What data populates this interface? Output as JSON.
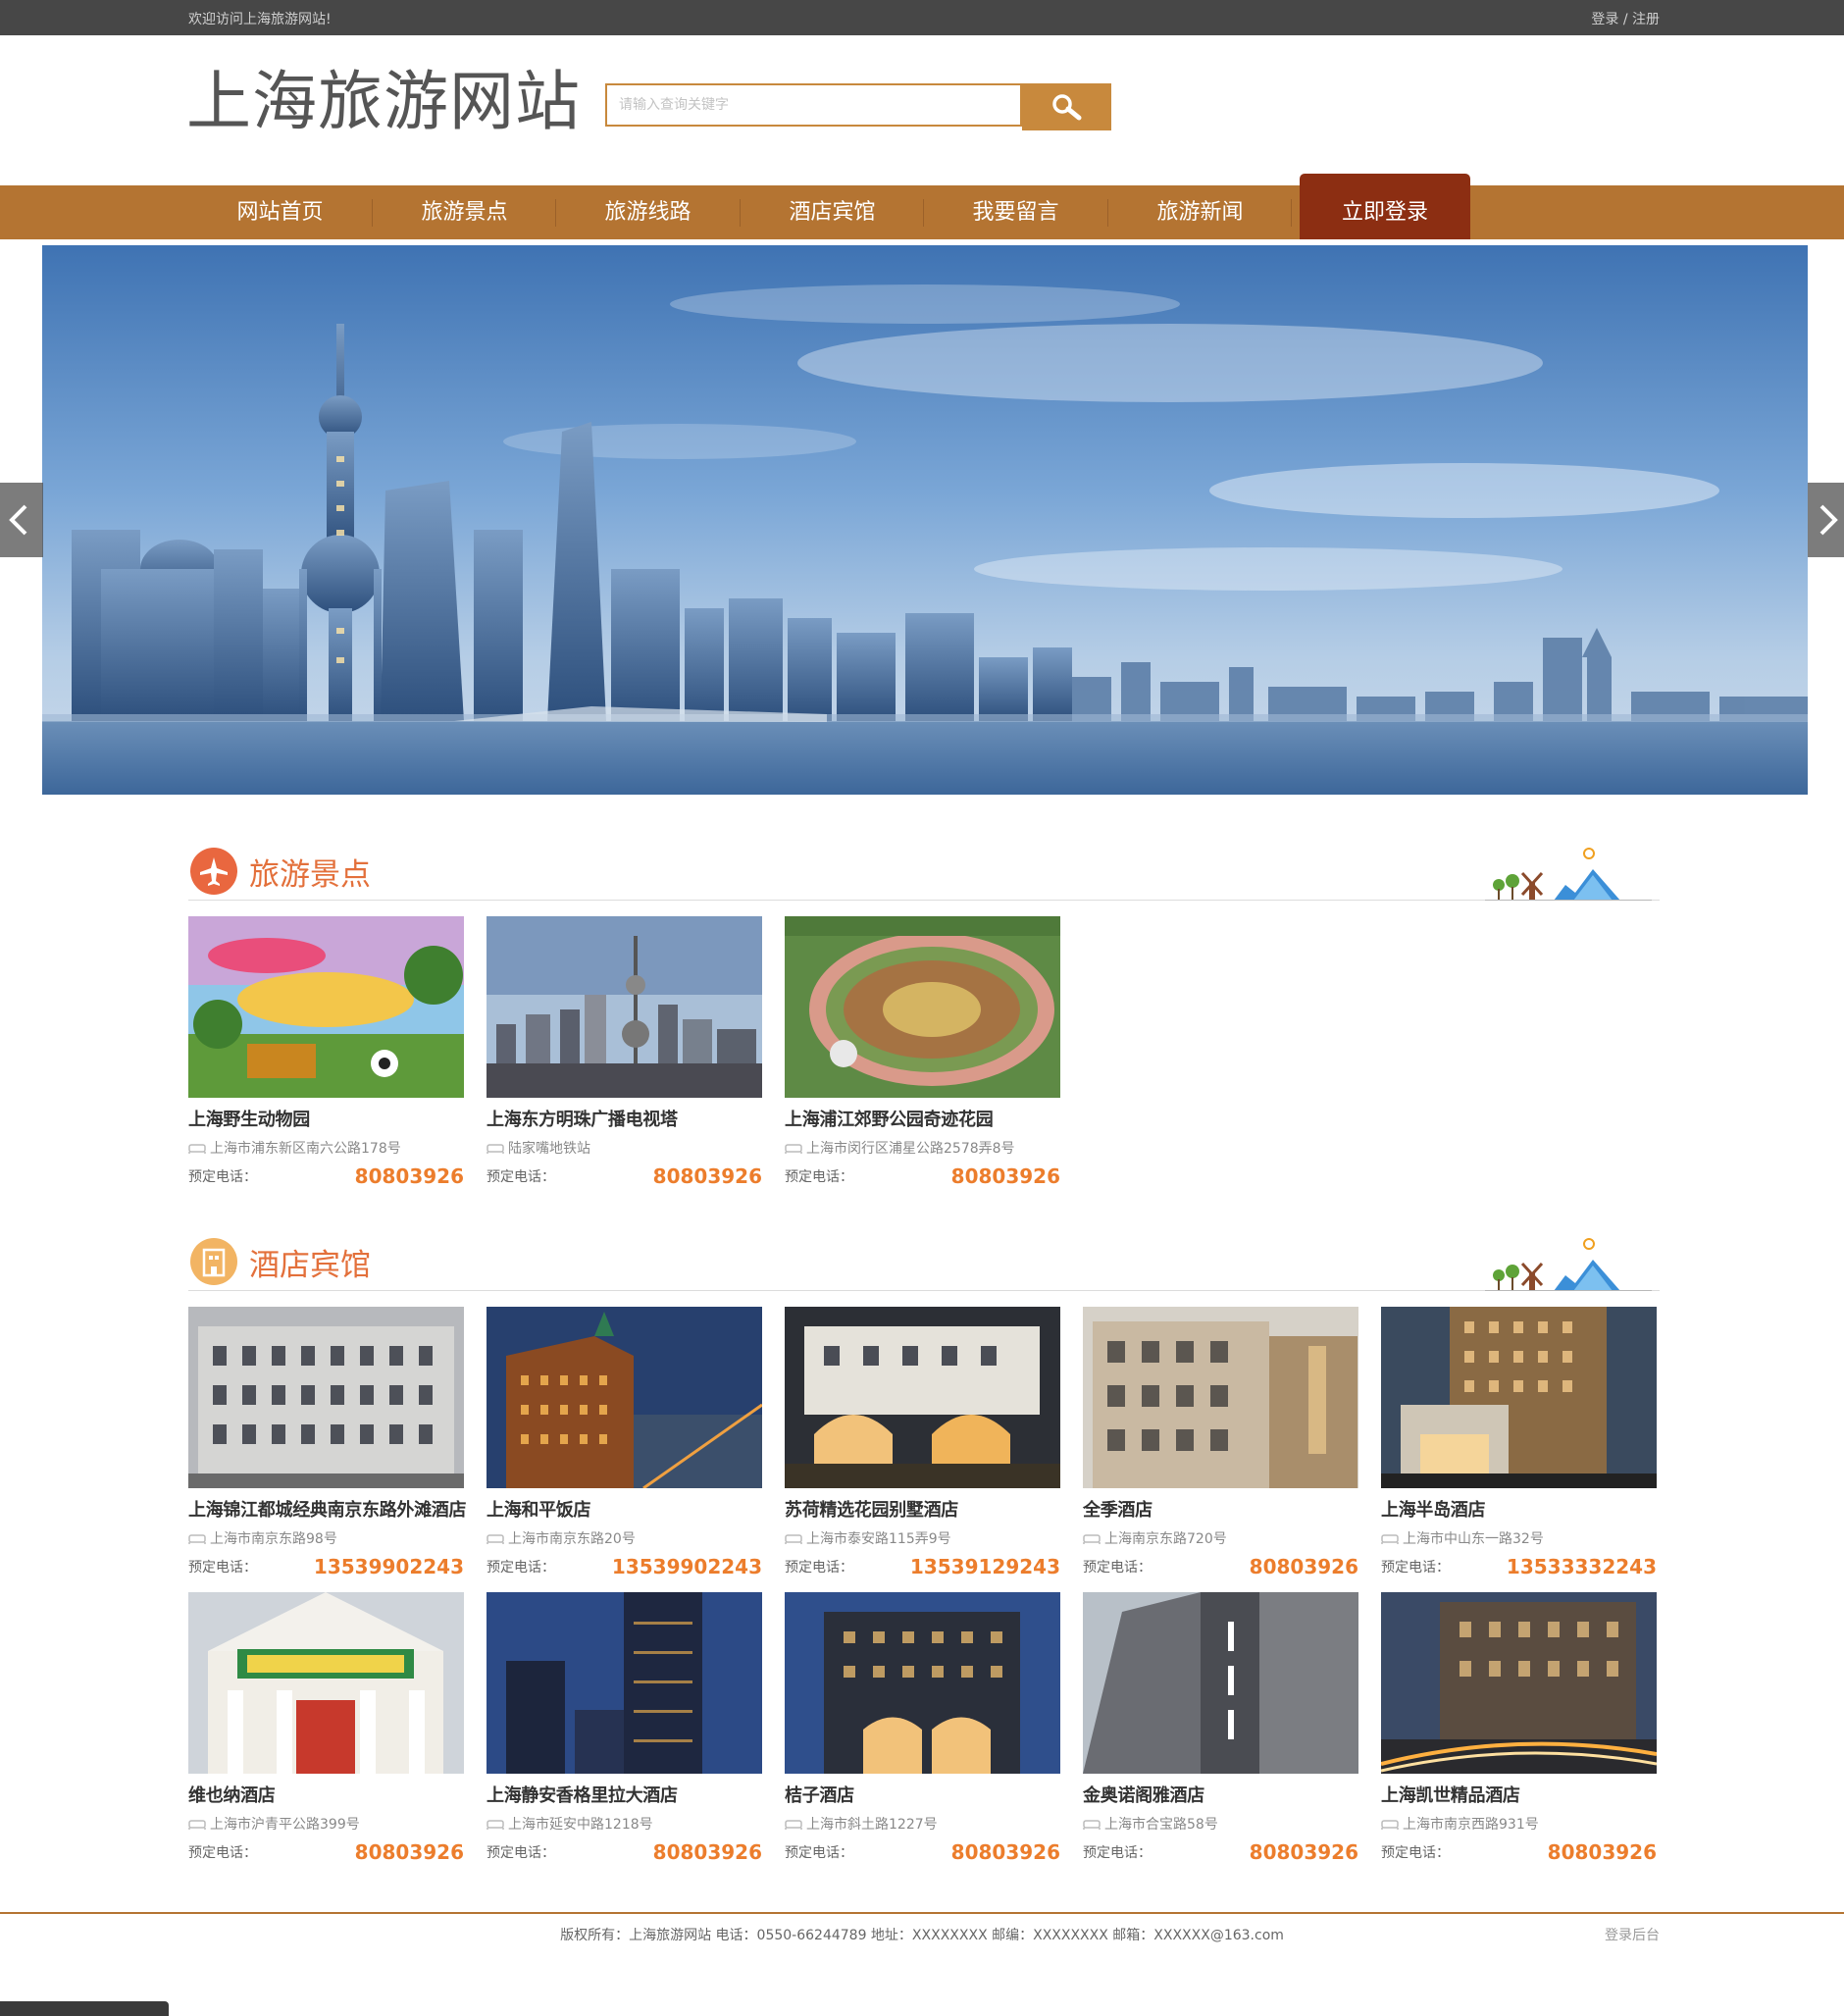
{
  "topbar": {
    "welcome": "欢迎访问上海旅游网站!",
    "login": "登录",
    "slash": " / ",
    "register": "注册"
  },
  "header": {
    "logo": "上海旅游网站",
    "search_placeholder": "请输入查询关键字"
  },
  "nav": [
    "网站首页",
    "旅游景点",
    "旅游线路",
    "酒店宾馆",
    "我要留言",
    "旅游新闻",
    "立即登录"
  ],
  "sections": {
    "spots": {
      "title": "旅游景点"
    },
    "hotels": {
      "title": "酒店宾馆"
    }
  },
  "phone_label": "预定电话：",
  "spots": [
    {
      "name": "上海野生动物园",
      "addr": "上海市浦东新区南六公路178号",
      "phone": "80803926"
    },
    {
      "name": "上海东方明珠广播电视塔",
      "addr": "陆家嘴地铁站",
      "phone": "80803926"
    },
    {
      "name": "上海浦江郊野公园奇迹花园",
      "addr": "上海市闵行区浦星公路2578弄8号",
      "phone": "80803926"
    }
  ],
  "hotels": [
    {
      "name": "上海锦江都城经典南京东路外滩酒店",
      "addr": "上海市南京东路98号",
      "phone": "13539902243"
    },
    {
      "name": "上海和平饭店",
      "addr": "上海市南京东路20号",
      "phone": "13539902243"
    },
    {
      "name": "苏荷精选花园别墅酒店",
      "addr": "上海市泰安路115弄9号",
      "phone": "13539129243"
    },
    {
      "name": "全季酒店",
      "addr": "上海南京东路720号",
      "phone": "80803926"
    },
    {
      "name": "上海半岛酒店",
      "addr": "上海市中山东一路32号",
      "phone": "13533332243"
    },
    {
      "name": "维也纳酒店",
      "addr": "上海市沪青平公路399号",
      "phone": "80803926"
    },
    {
      "name": "上海静安香格里拉大酒店",
      "addr": "上海市延安中路1218号",
      "phone": "80803926"
    },
    {
      "name": "桔子酒店",
      "addr": "上海市斜土路1227号",
      "phone": "80803926"
    },
    {
      "name": "金奥诺阁雅酒店",
      "addr": "上海市合宝路58号",
      "phone": "80803926"
    },
    {
      "name": "上海凯世精品酒店",
      "addr": "上海市南京西路931号",
      "phone": "80803926"
    }
  ],
  "footer": {
    "text": "版权所有：上海旅游网站 电话：0550-66244789 地址：XXXXXXXX 邮编：XXXXXXXX 邮箱：XXXXXX@163.com",
    "admin": "登录后台"
  }
}
